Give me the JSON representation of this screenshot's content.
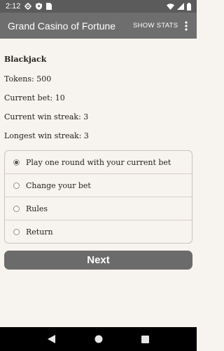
{
  "status_bar": {
    "time": "2:12",
    "icons": [
      "gear-icon",
      "shield-icon",
      "sim-card-icon",
      "wifi-icon",
      "signal-icon",
      "battery-icon"
    ]
  },
  "app_bar": {
    "title": "Grand Casino of Fortune",
    "show_stats_label": "SHOW STATS",
    "menu_icon": "more-vert-icon"
  },
  "game": {
    "title": "Blackjack",
    "tokens": "Tokens: 500",
    "current_bet": "Current bet: 10",
    "current_win_streak": "Current win streak: 3",
    "longest_win_streak": "Longest win streak: 3"
  },
  "options": [
    {
      "label": "Play one round with your current bet",
      "selected": true
    },
    {
      "label": "Change your bet",
      "selected": false
    },
    {
      "label": "Rules",
      "selected": false
    },
    {
      "label": "Return",
      "selected": false
    }
  ],
  "next_label": "Next",
  "nav_bar": {
    "icons": [
      "back-icon",
      "home-icon",
      "recents-icon"
    ]
  },
  "colors": {
    "status_bar": "#5b5b5b",
    "app_bar": "#6e6e6e",
    "background": "#f7f3ee",
    "button": "#6b6b6b"
  }
}
